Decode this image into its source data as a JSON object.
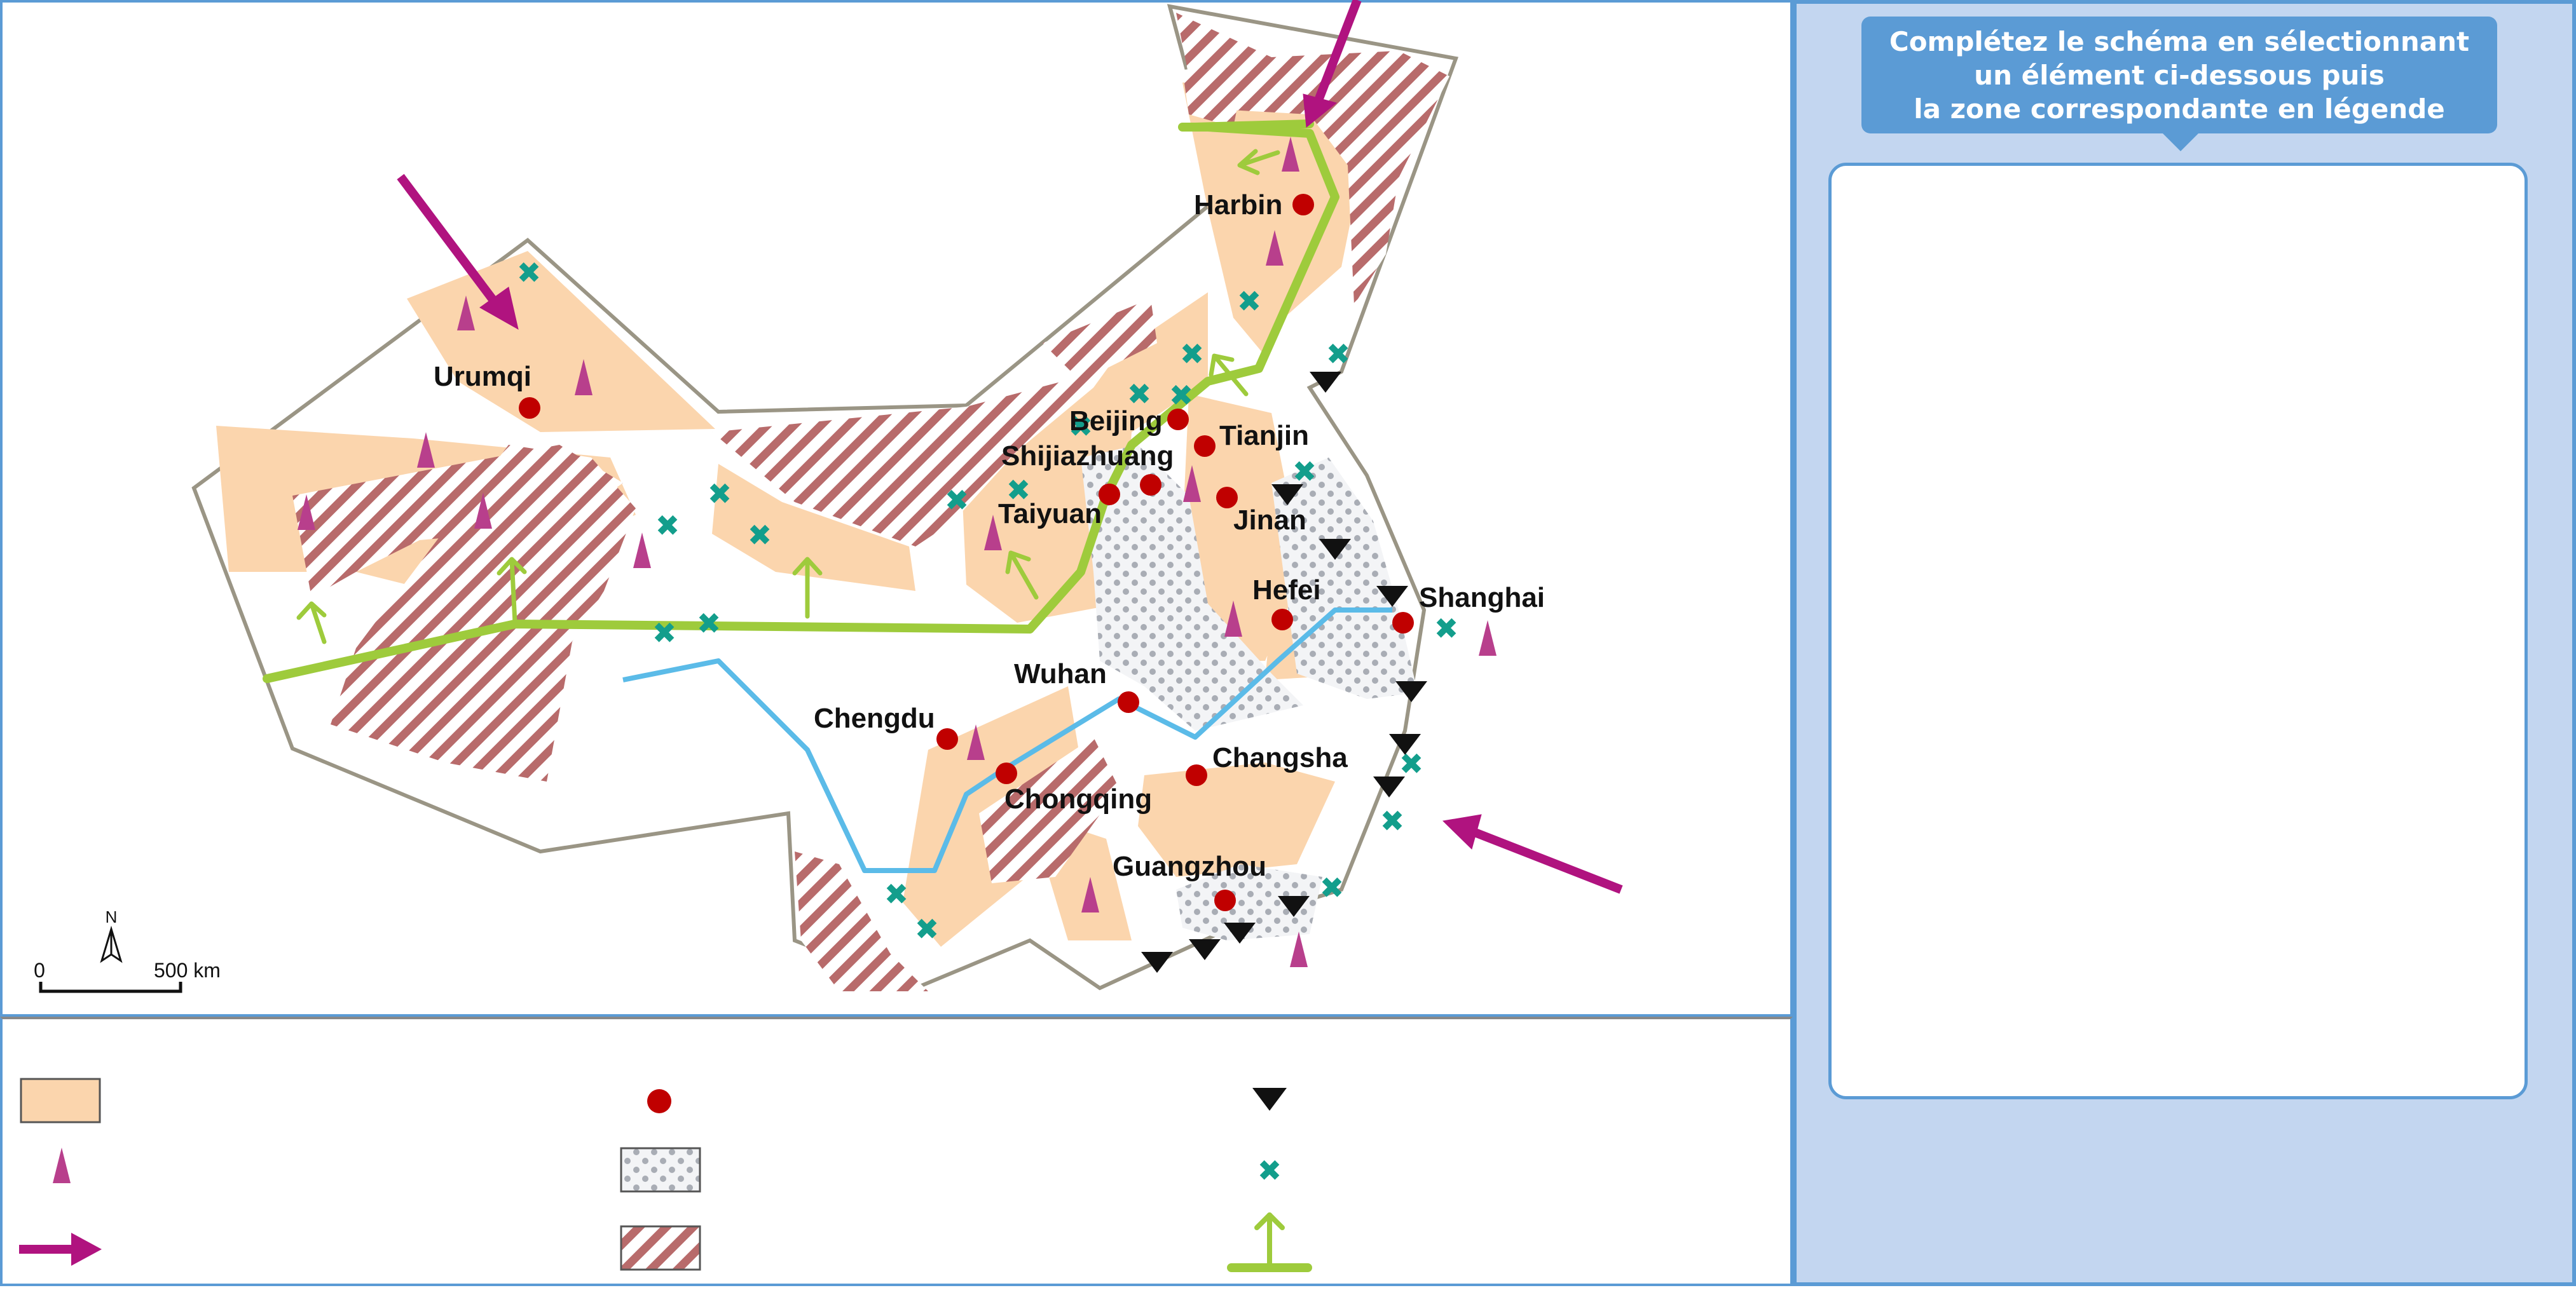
{
  "instruction": {
    "line1": "Complétez le schéma en sélectionnant",
    "line2": "un élément ci-dessous puis",
    "line3": "la zone correspondante en légende"
  },
  "map": {
    "cities": {
      "harbin": "Harbin",
      "urumqi": "Urumqi",
      "beijing": "Beijing",
      "tianjin": "Tianjin",
      "shijiazhuang": "Shijiazhuang",
      "taiyuan": "Taiyuan",
      "jinan": "Jinan",
      "hefei": "Hefei",
      "shanghai": "Shanghai",
      "wuhan": "Wuhan",
      "chengdu": "Chengdu",
      "chongqing": "Chongqing",
      "changsha": "Changsha",
      "guangzhou": "Guangzhou"
    },
    "north_arrow": "N",
    "scale": {
      "start": "0",
      "end": "500 km"
    }
  },
  "colors": {
    "agricultural_zone": "#fbd5ad",
    "hatch": "#b86b6b",
    "city": "#c00000",
    "triangle": "#b83f8c",
    "arrow": "#b0137f",
    "port": "#111111",
    "cross": "#139e8c",
    "axis": "#9ecb3c",
    "river": "#5bbbe8",
    "border": "#9a9585",
    "panel_border": "#5b9bd5"
  },
  "legend": {
    "items": [
      {
        "symbol": "orange-area",
        "label": ""
      },
      {
        "symbol": "red-dot",
        "label": ""
      },
      {
        "symbol": "black-triangle",
        "label": ""
      },
      {
        "symbol": "pink-triangle",
        "label": ""
      },
      {
        "symbol": "dotted-area",
        "label": ""
      },
      {
        "symbol": "green-cross",
        "label": ""
      },
      {
        "symbol": "magenta-arrow",
        "label": ""
      },
      {
        "symbol": "hatched-area",
        "label": ""
      },
      {
        "symbol": "green-axis-arrow",
        "label": ""
      }
    ]
  }
}
